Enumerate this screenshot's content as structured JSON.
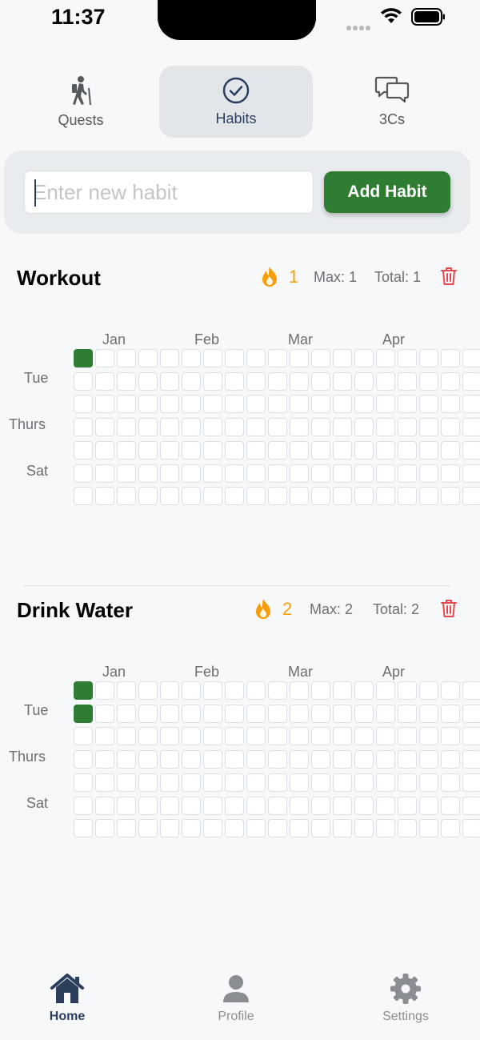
{
  "status": {
    "time": "11:37"
  },
  "tabs": [
    {
      "label": "Quests",
      "icon": "hiker-icon"
    },
    {
      "label": "Habits",
      "icon": "check-circle-icon",
      "active": true
    },
    {
      "label": "3Cs",
      "icon": "chat-bubbles-icon"
    }
  ],
  "add": {
    "placeholder": "Enter new habit",
    "value": "",
    "button_label": "Add Habit"
  },
  "calendar": {
    "months": [
      "Jan",
      "Feb",
      "Mar",
      "Apr"
    ],
    "day_labels": [
      "Tue",
      "Thurs",
      "Sat"
    ]
  },
  "habits": [
    {
      "name": "Workout",
      "streak": "1",
      "max": "Max: 1",
      "total": "Total: 1",
      "filled": [
        [
          0,
          0
        ]
      ]
    },
    {
      "name": "Drink Water",
      "streak": "2",
      "max": "Max: 2",
      "total": "Total: 2",
      "filled": [
        [
          0,
          0
        ],
        [
          0,
          1
        ]
      ]
    }
  ],
  "nav": [
    {
      "label": "Home",
      "icon": "home-icon",
      "active": true
    },
    {
      "label": "Profile",
      "icon": "person-icon"
    },
    {
      "label": "Settings",
      "icon": "gear-icon"
    }
  ],
  "colors": {
    "accent": "#2e7d32",
    "flame": "#f59e0b",
    "danger": "#e5484d",
    "nav_active": "#2b3f5c"
  }
}
